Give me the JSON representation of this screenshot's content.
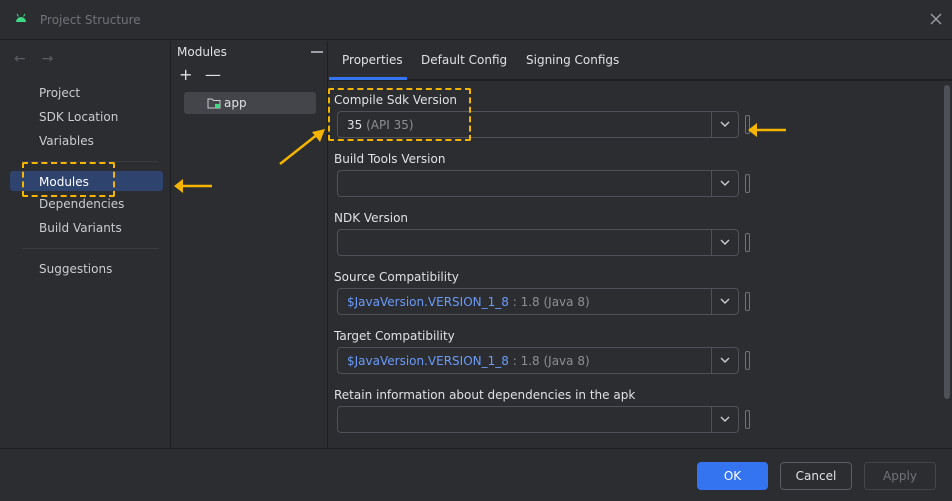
{
  "window": {
    "title": "Project Structure"
  },
  "sidebar": {
    "nav_back": "←",
    "nav_forward": "→",
    "items": [
      {
        "label": "Project"
      },
      {
        "label": "SDK Location"
      },
      {
        "label": "Variables"
      },
      {
        "label": "Modules"
      },
      {
        "label": "Dependencies"
      },
      {
        "label": "Build Variants"
      },
      {
        "label": "Suggestions"
      }
    ],
    "selected": "Modules"
  },
  "modules": {
    "header": "Modules",
    "add_label": "+",
    "remove_label": "—",
    "items": [
      {
        "label": "app"
      }
    ]
  },
  "tabs": [
    {
      "label": "Properties"
    },
    {
      "label": "Default Config"
    },
    {
      "label": "Signing Configs"
    }
  ],
  "active_tab": "Properties",
  "fields": {
    "compile_sdk": {
      "label": "Compile Sdk Version",
      "value": "35",
      "hint": " (API 35)"
    },
    "build_tools": {
      "label": "Build Tools Version",
      "value": ""
    },
    "ndk": {
      "label": "NDK Version",
      "value": ""
    },
    "source_compat": {
      "label": "Source Compatibility",
      "value": "$JavaVersion.VERSION_1_8",
      "hint": " : 1.8 (Java 8)"
    },
    "target_compat": {
      "label": "Target Compatibility",
      "value": "$JavaVersion.VERSION_1_8",
      "hint": " : 1.8 (Java 8)"
    },
    "retain_info": {
      "label": "Retain information about dependencies in the apk",
      "value": ""
    }
  },
  "buttons": {
    "ok": "OK",
    "cancel": "Cancel",
    "apply": "Apply"
  },
  "colors": {
    "accent": "#3574f0",
    "annotation": "#f5b400",
    "background": "#2b2d30"
  }
}
